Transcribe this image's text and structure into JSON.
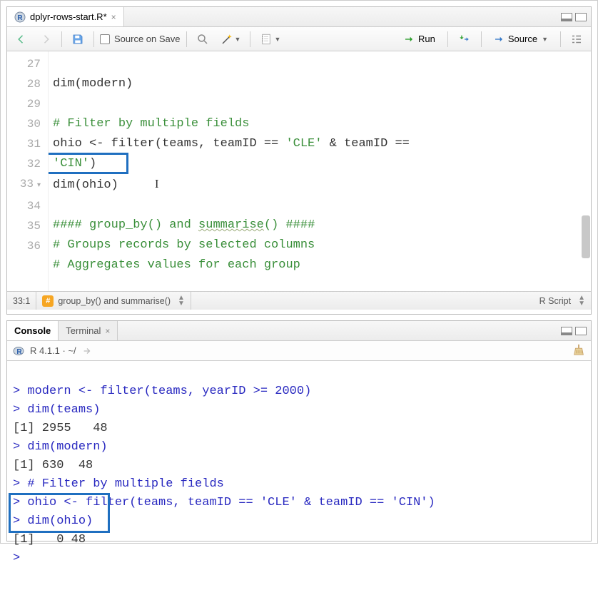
{
  "editor": {
    "tab": {
      "filename": "dplyr-rows-start.R*"
    },
    "toolbar": {
      "source_on_save": "Source on Save",
      "run": "Run",
      "source": "Source"
    },
    "gutter": [
      "27",
      "28",
      "29",
      "30",
      "",
      "31",
      "32",
      "33",
      "34",
      "35",
      "36"
    ],
    "lines": {
      "l27": "dim(modern)",
      "l28": "",
      "l29": "# Filter by multiple fields",
      "l30a": "ohio <- filter(teams, teamID == ",
      "l30s1": "'CLE'",
      "l30m": " & teamID == ",
      "l30s2": "'CIN'",
      "l30e": ")",
      "l31": "dim(ohio)",
      "l32": "",
      "l33a": "#### group_by() and ",
      "l33b": "summarise",
      "l33c": "() ####",
      "l34": "# Groups records by selected columns",
      "l35": "# Aggregates values for each group",
      "l36": ""
    },
    "status": {
      "pos": "33:1",
      "section": "group_by() and summarise()",
      "lang": "R Script"
    }
  },
  "console": {
    "tabs": {
      "console": "Console",
      "terminal": "Terminal"
    },
    "version": "R 4.1.1 · ~/",
    "lines": {
      "p1": "> modern <- filter(teams, yearID >= 2000)",
      "p2": "> dim(teams)",
      "o2": "[1] 2955   48",
      "p3": "> dim(modern)",
      "o3": "[1] 630  48",
      "p4": "> # Filter by multiple fields",
      "p5": "> ohio <- filter(teams, teamID == 'CLE' & teamID == 'CIN')",
      "p6": "> dim(ohio)",
      "o6": "[1]   0 48",
      "p7": "> "
    }
  }
}
